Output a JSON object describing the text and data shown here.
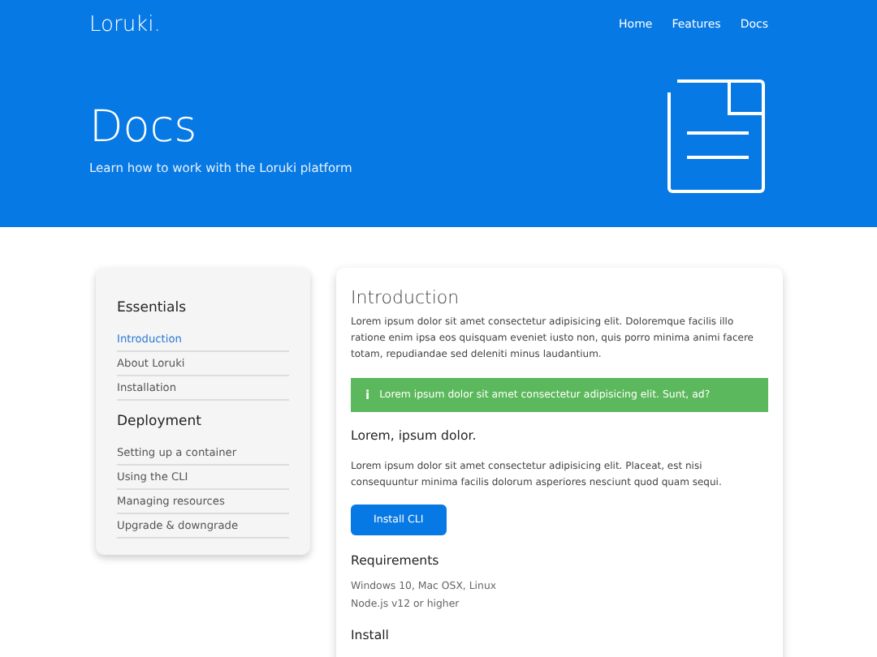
{
  "navbar": {
    "brand": "Loruki.",
    "links": [
      {
        "label": "Home"
      },
      {
        "label": "Features"
      },
      {
        "label": "Docs"
      }
    ]
  },
  "hero": {
    "title": "Docs",
    "subtitle": "Learn how to work with the Loruki platform"
  },
  "sidebar": {
    "sections": [
      {
        "title": "Essentials",
        "items": [
          {
            "label": "Introduction",
            "selected": true
          },
          {
            "label": "About Loruki",
            "selected": false
          },
          {
            "label": "Installation",
            "selected": false
          }
        ]
      },
      {
        "title": "Deployment",
        "items": [
          {
            "label": "Setting up a container",
            "selected": false
          },
          {
            "label": "Using the CLI",
            "selected": false
          },
          {
            "label": "Managing resources",
            "selected": false
          },
          {
            "label": "Upgrade & downgrade",
            "selected": false
          }
        ]
      }
    ]
  },
  "article": {
    "title": "Introduction",
    "intro": "Lorem ipsum dolor sit amet consectetur adipisicing elit. Doloremque facilis illo ratione enim ipsa eos quisquam eveniet iusto non, quis porro minima animi facere totam, repudiandae sed deleniti minus laudantium.",
    "alert": {
      "icon": "i",
      "text": "Lorem ipsum dolor sit amet consectetur adipisicing elit. Sunt, ad?"
    },
    "subtitle": "Lorem, ipsum dolor.",
    "paragraph": "Lorem ipsum dolor sit amet consectetur adipisicing elit. Placeat, est nisi consequuntur minima facilis dolorum asperiores nesciunt quod quam sequi.",
    "button": "Install CLI",
    "requirements_title": "Requirements",
    "requirements": [
      "Windows 10, Mac OSX, Linux",
      "Node.js v12 or higher"
    ],
    "install_title": "Install"
  }
}
